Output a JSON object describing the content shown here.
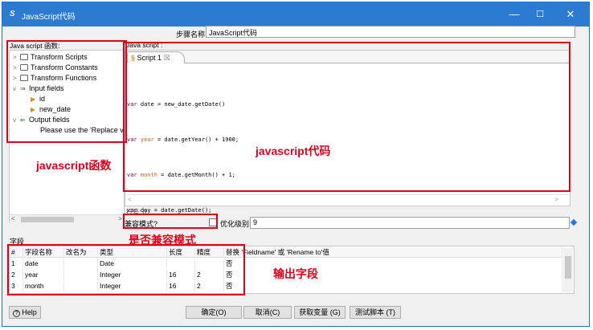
{
  "window": {
    "title": "JavaScript代码",
    "app_icon": "S",
    "minimize": "—",
    "maximize": "☐",
    "close": "✕"
  },
  "step": {
    "label": "步骤名称",
    "value": "JavaScript代码"
  },
  "tree": {
    "title": "Java script 函数:",
    "items": [
      {
        "label": "Transform Scripts",
        "twisty": ">",
        "icon": "folder-icon"
      },
      {
        "label": "Transform Constants",
        "twisty": ">",
        "icon": "folder-icon"
      },
      {
        "label": "Transform Functions",
        "twisty": ">",
        "icon": "folder-icon"
      },
      {
        "label": "Input fields",
        "twisty": "v",
        "icon": "input-fields-icon"
      },
      {
        "label": "id",
        "icon": "field-arrow-icon"
      },
      {
        "label": "new_date",
        "icon": "field-arrow-icon"
      },
      {
        "label": "Output fields",
        "twisty": "v",
        "icon": "output-fields-icon"
      },
      {
        "label": "Please use the 'Replace v"
      }
    ]
  },
  "editor": {
    "label": "Java script :",
    "tab_label": "Script 1",
    "tab_close": "☒",
    "code_lines": [
      [
        "var",
        " date = new_date.getDate()"
      ],
      [
        "var",
        " ",
        "year",
        " = date.getYear() + 1900;"
      ],
      [
        "var",
        " ",
        "month",
        " = date.getMonth() + 1;"
      ],
      [
        "var",
        " day = date.getDate();"
      ]
    ],
    "row_text": "行号: 0"
  },
  "compat": {
    "label": "兼容模式?",
    "checked": false
  },
  "optimize": {
    "label": "优化级别",
    "value": "9"
  },
  "fields": {
    "label": "字段",
    "columns": [
      "#",
      "字段名称",
      "改名为",
      "类型",
      "长度",
      "精度",
      "替换 'Fieldname' 或 'Rename to'值"
    ],
    "rows": [
      [
        "1",
        "date",
        "",
        "Date",
        "",
        "",
        "否"
      ],
      [
        "2",
        "year",
        "",
        "Integer",
        "16",
        "2",
        "否"
      ],
      [
        "3",
        "month",
        "",
        "Integer",
        "16",
        "2",
        "否"
      ]
    ]
  },
  "buttons": {
    "help": "Help",
    "ok": "确定(O)",
    "cancel": "取消(C)",
    "get_vars": "获取变量 (G)",
    "test": "测试脚本 (T)"
  },
  "annotations": {
    "functions": "javascript函数",
    "code": "javascript代码",
    "compat": "是否兼容模式",
    "output": "输出字段"
  },
  "colors": {
    "title_bar": "#2b7bd3",
    "annotation": "#e0001b"
  }
}
